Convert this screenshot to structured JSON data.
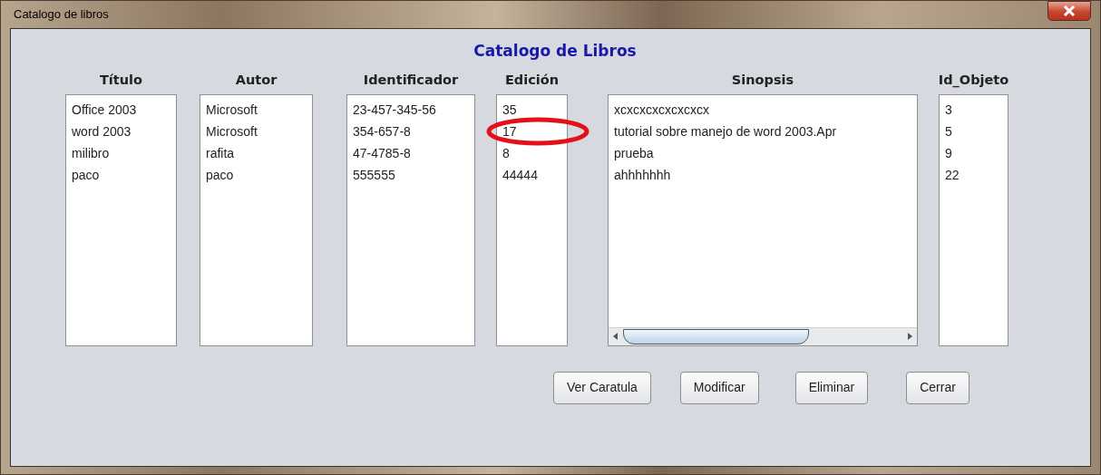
{
  "window": {
    "title": "Catalogo de libros"
  },
  "heading": "Catalogo de Libros",
  "columns": [
    {
      "header": "Título",
      "kind": "plain",
      "items": [
        "Office 2003",
        "word 2003",
        "milibro",
        "paco"
      ]
    },
    {
      "header": "Autor",
      "kind": "plain",
      "items": [
        "Microsoft",
        "Microsoft",
        "rafita",
        "paco"
      ]
    },
    {
      "header": "Identificador",
      "kind": "plain",
      "items": [
        "23-457-345-56",
        "354-657-8",
        "47-4785-8",
        "555555"
      ]
    },
    {
      "header": "Edición",
      "kind": "plain",
      "items": [
        {
          "text": "35",
          "circled": false
        },
        {
          "text": "17",
          "circled": true
        },
        {
          "text": "8",
          "circled": false
        },
        {
          "text": "44444",
          "circled": false
        }
      ]
    },
    {
      "header": "Sinopsis",
      "kind": "scrolling",
      "items": [
        "xcxcxcxcxcxcxcx",
        "tutorial sobre manejo de word 2003.Apr",
        "prueba",
        "ahhhhhhh"
      ]
    },
    {
      "header": "Id_Objeto",
      "kind": "plain",
      "items": [
        "3",
        "5",
        "9",
        "22"
      ]
    }
  ],
  "buttons": [
    "Ver Caratula",
    "Modificar",
    "Eliminar",
    "Cerrar"
  ]
}
